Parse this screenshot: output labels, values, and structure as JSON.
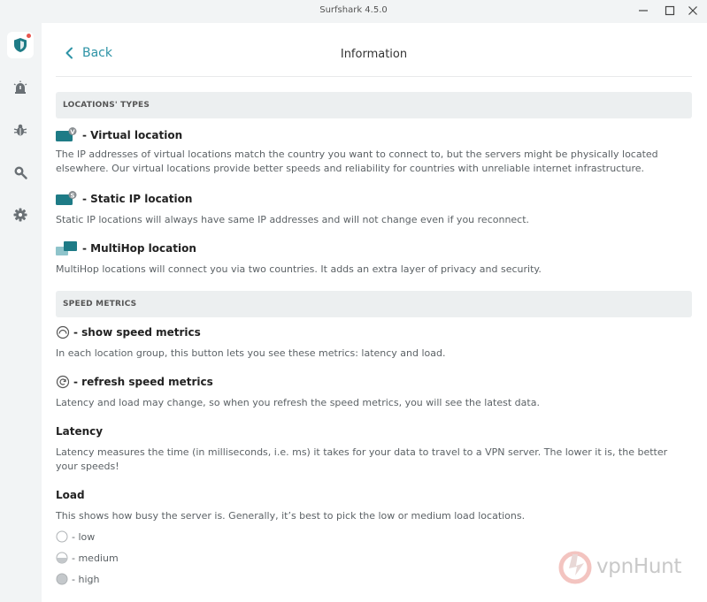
{
  "window": {
    "title": "Surfshark 4.5.0"
  },
  "header": {
    "back_label": "Back",
    "title": "Information"
  },
  "sections": {
    "locations_types": "LOCATIONS' TYPES",
    "speed_metrics": "SPEED METRICS"
  },
  "locations": {
    "virtual": {
      "title": "- Virtual location",
      "badge": "V",
      "desc": "The IP addresses of virtual locations match the country you want to connect to, but the servers might be physically located elsewhere. Our virtual locations provide better speeds and reliability for countries with unreliable internet infrastructure."
    },
    "static": {
      "title": "- Static IP location",
      "badge": "S",
      "desc": "Static IP locations will always have same IP addresses and  will not change even if you reconnect."
    },
    "multihop": {
      "title": "- MultiHop location",
      "desc": "MultiHop locations will connect you via two countries. It adds an extra layer of privacy and security."
    }
  },
  "metrics": {
    "show": {
      "title": "- show speed metrics",
      "desc": "In each location group, this button lets you see these metrics: latency and load."
    },
    "refresh": {
      "title": "- refresh speed metrics",
      "desc": "Latency and load may change, so when you refresh the speed metrics, you will see the latest data."
    }
  },
  "latency": {
    "title": "Latency",
    "desc": "Latency measures the time (in milliseconds, i.e. ms) it takes for your data to travel to a VPN server. The lower it is, the better your speeds!"
  },
  "load": {
    "title": "Load",
    "desc": "This shows how busy the server is. Generally, it’s best to pick the low or medium load locations.",
    "levels": [
      {
        "label": "- low",
        "fill": 0
      },
      {
        "label": "- medium",
        "fill": 0.5
      },
      {
        "label": "- high",
        "fill": 1
      }
    ]
  },
  "watermark": {
    "text": "vpnHunt"
  },
  "colors": {
    "accent": "#2d93a6",
    "brand_teal": "#1e7b86",
    "notification": "#e8554e"
  },
  "icons": {
    "sidebar": [
      "vpn-shield-icon",
      "alert-icon",
      "bug-icon",
      "search-icon",
      "settings-gear-icon"
    ]
  }
}
